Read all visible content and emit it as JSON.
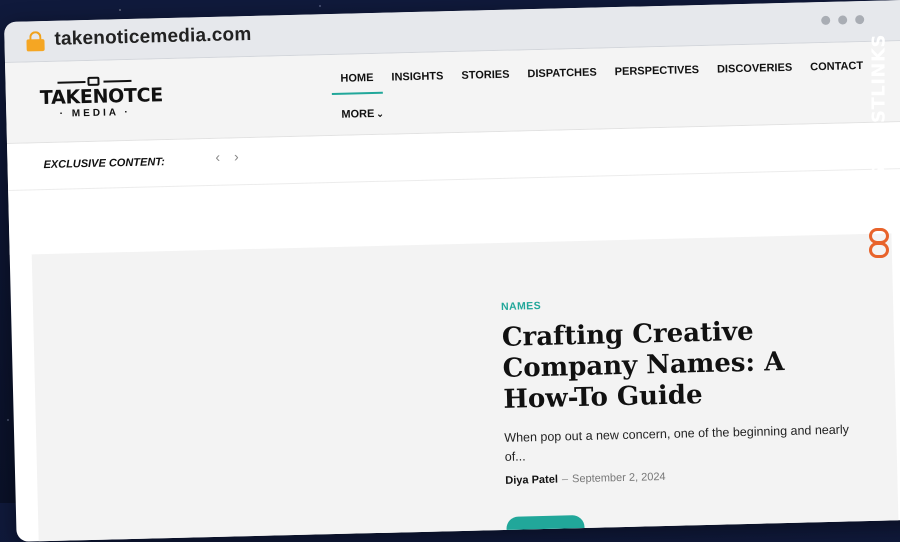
{
  "browser": {
    "url": "takenoticemedia.com"
  },
  "site": {
    "logo": {
      "name": "TAKENOTCE",
      "sub": "· MEDIA ·"
    },
    "nav": {
      "items": [
        "HOME",
        "INSIGHTS",
        "STORIES",
        "DISPATCHES",
        "PERSPECTIVES",
        "DISCOVERIES",
        "CONTACT"
      ],
      "active": "HOME",
      "more_label": "MORE"
    },
    "exclusive_label": "EXCLUSIVE CONTENT:",
    "arrows": {
      "prev": "‹",
      "next": "›"
    }
  },
  "hero": {
    "category": "NAMES",
    "headline": "Crafting Creative Company Names: A How-To Guide",
    "excerpt": "When pop out a new concern, one of the beginning and nearly of...",
    "author": "Diya Patel",
    "separator": "–",
    "date": "September 2, 2024"
  },
  "side_brand": {
    "text": "GUESTPOSTLINKS"
  },
  "colors": {
    "accent": "#21a79a",
    "lock": "#f5a623",
    "brand": "#e8632b"
  }
}
